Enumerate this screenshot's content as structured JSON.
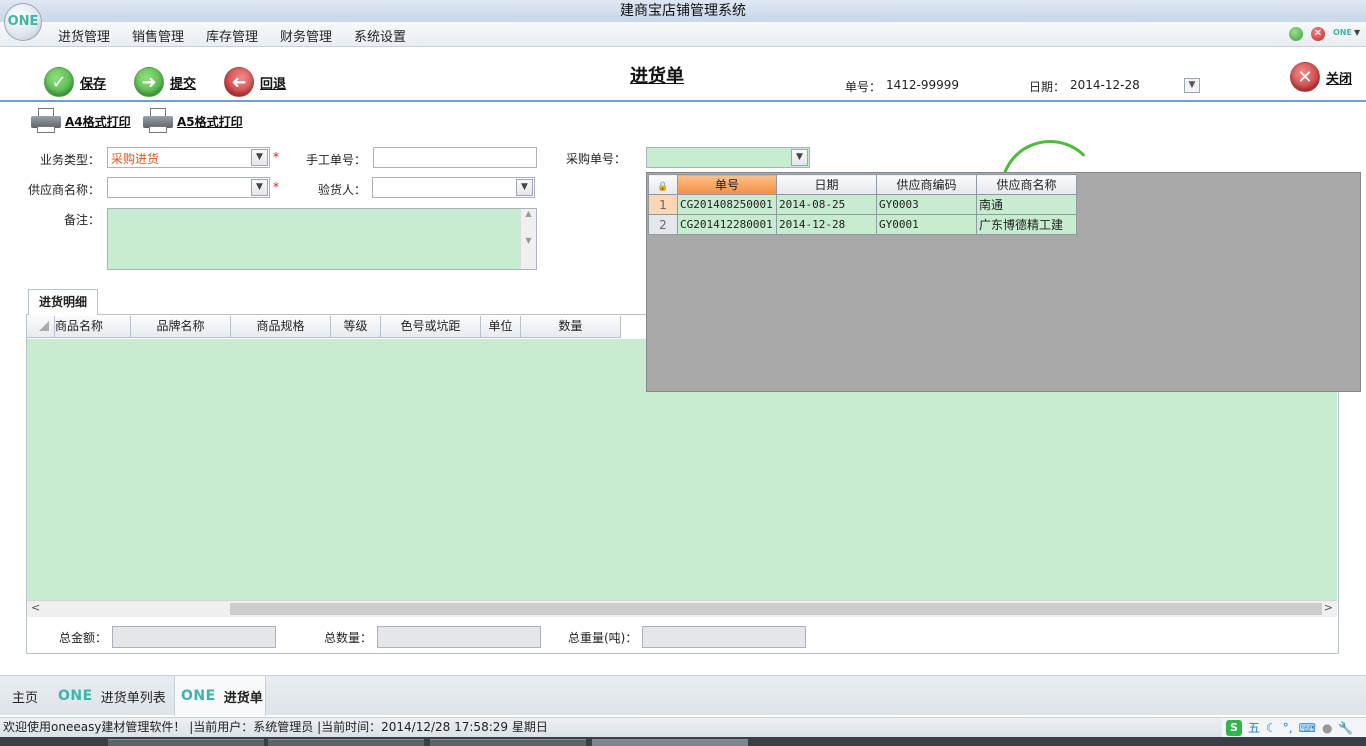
{
  "window": {
    "title": "建商宝店铺管理系统",
    "logo_text": "ONE"
  },
  "menu": {
    "items": [
      "进货管理",
      "销售管理",
      "库存管理",
      "财务管理",
      "系统设置"
    ],
    "right_badge": "ONE"
  },
  "toolbar": {
    "save": "保存",
    "submit": "提交",
    "back": "回退",
    "doc_title": "进货单",
    "doc_no_label": "单号：",
    "doc_no": "1412-99999",
    "date_label": "日期：",
    "date": "2014-12-28",
    "close": "关闭"
  },
  "print": {
    "a4": "A4格式打印",
    "a5": "A5格式打印"
  },
  "form": {
    "biz_type_label": "业务类型：",
    "biz_type_value": "采购进货",
    "manual_no_label": "手工单号：",
    "manual_no_value": "",
    "purchase_no_label": "采购单号：",
    "purchase_no_value": "",
    "supplier_label": "供应商名称：",
    "supplier_value": "",
    "inspector_label": "验货人：",
    "inspector_value": "",
    "remark_label": "备注：",
    "remark_value": "",
    "required_mark": "*"
  },
  "detail": {
    "tab_label": "进货明细",
    "columns": [
      "商品名称",
      "品牌名称",
      "商品规格",
      "等级",
      "色号或坑距",
      "单位",
      "数量"
    ]
  },
  "summary": {
    "total_amount_label": "总金额：",
    "total_qty_label": "总数量：",
    "total_weight_label": "总重量(吨)："
  },
  "popup": {
    "columns": [
      "单号",
      "日期",
      "供应商编码",
      "供应商名称"
    ],
    "rows": [
      {
        "n": "1",
        "no": "CG201408250001",
        "date": "2014-08-25",
        "code": "GY0003",
        "name": "南通"
      },
      {
        "n": "2",
        "no": "CG201412280001",
        "date": "2014-12-28",
        "code": "GY0001",
        "name": "广东博德精工建"
      }
    ]
  },
  "bottom_tabs": {
    "home": "主页",
    "badge": "ONE",
    "list": "进货单列表",
    "current": "进货单"
  },
  "status": {
    "text": "欢迎使用oneeasy建材管理软件！  |当前用户：系统管理员  |当前时间：2014/12/28 17:58:29   星期日",
    "ime_mode": "五"
  }
}
